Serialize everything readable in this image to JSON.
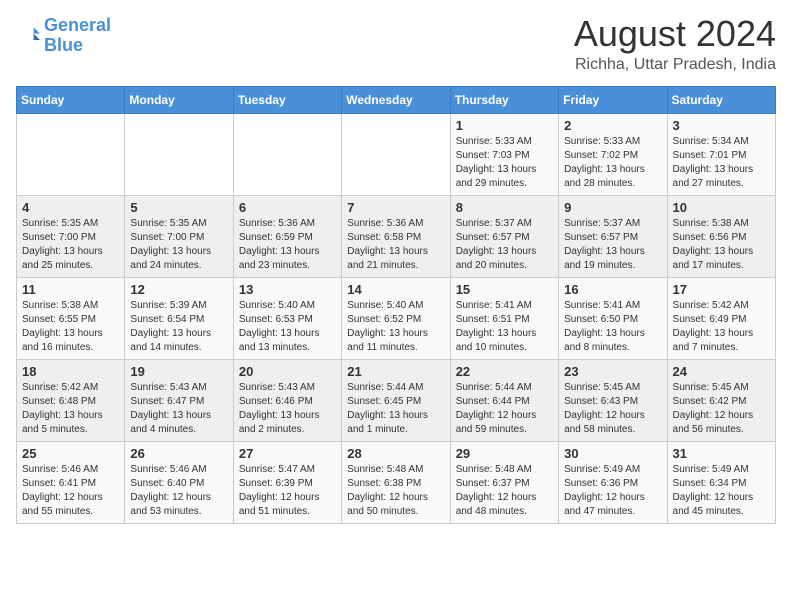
{
  "logo": {
    "line1": "General",
    "line2": "Blue"
  },
  "title": "August 2024",
  "location": "Richha, Uttar Pradesh, India",
  "weekdays": [
    "Sunday",
    "Monday",
    "Tuesday",
    "Wednesday",
    "Thursday",
    "Friday",
    "Saturday"
  ],
  "weeks": [
    [
      {
        "day": "",
        "content": ""
      },
      {
        "day": "",
        "content": ""
      },
      {
        "day": "",
        "content": ""
      },
      {
        "day": "",
        "content": ""
      },
      {
        "day": "1",
        "content": "Sunrise: 5:33 AM\nSunset: 7:03 PM\nDaylight: 13 hours\nand 29 minutes."
      },
      {
        "day": "2",
        "content": "Sunrise: 5:33 AM\nSunset: 7:02 PM\nDaylight: 13 hours\nand 28 minutes."
      },
      {
        "day": "3",
        "content": "Sunrise: 5:34 AM\nSunset: 7:01 PM\nDaylight: 13 hours\nand 27 minutes."
      }
    ],
    [
      {
        "day": "4",
        "content": "Sunrise: 5:35 AM\nSunset: 7:00 PM\nDaylight: 13 hours\nand 25 minutes."
      },
      {
        "day": "5",
        "content": "Sunrise: 5:35 AM\nSunset: 7:00 PM\nDaylight: 13 hours\nand 24 minutes."
      },
      {
        "day": "6",
        "content": "Sunrise: 5:36 AM\nSunset: 6:59 PM\nDaylight: 13 hours\nand 23 minutes."
      },
      {
        "day": "7",
        "content": "Sunrise: 5:36 AM\nSunset: 6:58 PM\nDaylight: 13 hours\nand 21 minutes."
      },
      {
        "day": "8",
        "content": "Sunrise: 5:37 AM\nSunset: 6:57 PM\nDaylight: 13 hours\nand 20 minutes."
      },
      {
        "day": "9",
        "content": "Sunrise: 5:37 AM\nSunset: 6:57 PM\nDaylight: 13 hours\nand 19 minutes."
      },
      {
        "day": "10",
        "content": "Sunrise: 5:38 AM\nSunset: 6:56 PM\nDaylight: 13 hours\nand 17 minutes."
      }
    ],
    [
      {
        "day": "11",
        "content": "Sunrise: 5:38 AM\nSunset: 6:55 PM\nDaylight: 13 hours\nand 16 minutes."
      },
      {
        "day": "12",
        "content": "Sunrise: 5:39 AM\nSunset: 6:54 PM\nDaylight: 13 hours\nand 14 minutes."
      },
      {
        "day": "13",
        "content": "Sunrise: 5:40 AM\nSunset: 6:53 PM\nDaylight: 13 hours\nand 13 minutes."
      },
      {
        "day": "14",
        "content": "Sunrise: 5:40 AM\nSunset: 6:52 PM\nDaylight: 13 hours\nand 11 minutes."
      },
      {
        "day": "15",
        "content": "Sunrise: 5:41 AM\nSunset: 6:51 PM\nDaylight: 13 hours\nand 10 minutes."
      },
      {
        "day": "16",
        "content": "Sunrise: 5:41 AM\nSunset: 6:50 PM\nDaylight: 13 hours\nand 8 minutes."
      },
      {
        "day": "17",
        "content": "Sunrise: 5:42 AM\nSunset: 6:49 PM\nDaylight: 13 hours\nand 7 minutes."
      }
    ],
    [
      {
        "day": "18",
        "content": "Sunrise: 5:42 AM\nSunset: 6:48 PM\nDaylight: 13 hours\nand 5 minutes."
      },
      {
        "day": "19",
        "content": "Sunrise: 5:43 AM\nSunset: 6:47 PM\nDaylight: 13 hours\nand 4 minutes."
      },
      {
        "day": "20",
        "content": "Sunrise: 5:43 AM\nSunset: 6:46 PM\nDaylight: 13 hours\nand 2 minutes."
      },
      {
        "day": "21",
        "content": "Sunrise: 5:44 AM\nSunset: 6:45 PM\nDaylight: 13 hours\nand 1 minute."
      },
      {
        "day": "22",
        "content": "Sunrise: 5:44 AM\nSunset: 6:44 PM\nDaylight: 12 hours\nand 59 minutes."
      },
      {
        "day": "23",
        "content": "Sunrise: 5:45 AM\nSunset: 6:43 PM\nDaylight: 12 hours\nand 58 minutes."
      },
      {
        "day": "24",
        "content": "Sunrise: 5:45 AM\nSunset: 6:42 PM\nDaylight: 12 hours\nand 56 minutes."
      }
    ],
    [
      {
        "day": "25",
        "content": "Sunrise: 5:46 AM\nSunset: 6:41 PM\nDaylight: 12 hours\nand 55 minutes."
      },
      {
        "day": "26",
        "content": "Sunrise: 5:46 AM\nSunset: 6:40 PM\nDaylight: 12 hours\nand 53 minutes."
      },
      {
        "day": "27",
        "content": "Sunrise: 5:47 AM\nSunset: 6:39 PM\nDaylight: 12 hours\nand 51 minutes."
      },
      {
        "day": "28",
        "content": "Sunrise: 5:48 AM\nSunset: 6:38 PM\nDaylight: 12 hours\nand 50 minutes."
      },
      {
        "day": "29",
        "content": "Sunrise: 5:48 AM\nSunset: 6:37 PM\nDaylight: 12 hours\nand 48 minutes."
      },
      {
        "day": "30",
        "content": "Sunrise: 5:49 AM\nSunset: 6:36 PM\nDaylight: 12 hours\nand 47 minutes."
      },
      {
        "day": "31",
        "content": "Sunrise: 5:49 AM\nSunset: 6:34 PM\nDaylight: 12 hours\nand 45 minutes."
      }
    ]
  ]
}
